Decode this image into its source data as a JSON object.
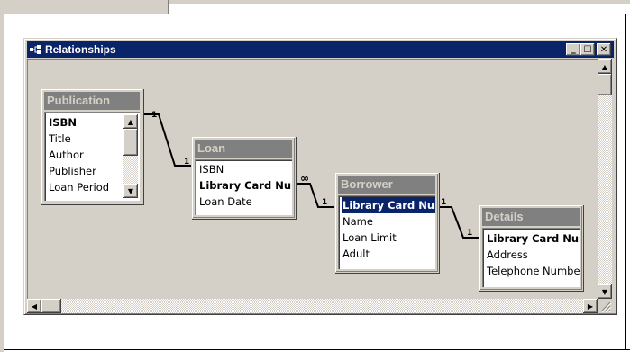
{
  "window": {
    "title": "Relationships",
    "buttons": {
      "minimize": "_",
      "maximize": "☐",
      "close": "✕"
    }
  },
  "tables": [
    {
      "name": "Publication",
      "fields": [
        {
          "label": "ISBN",
          "key": true
        },
        {
          "label": "Title",
          "key": false
        },
        {
          "label": "Author",
          "key": false
        },
        {
          "label": "Publisher",
          "key": false
        },
        {
          "label": "Loan Period",
          "key": false
        }
      ]
    },
    {
      "name": "Loan",
      "fields": [
        {
          "label": "ISBN",
          "key": false
        },
        {
          "label": "Library Card Num",
          "key": true
        },
        {
          "label": "Loan Date",
          "key": false
        }
      ]
    },
    {
      "name": "Borrower",
      "fields": [
        {
          "label": "Library Card Num",
          "key": true,
          "selected": true
        },
        {
          "label": "Name",
          "key": false
        },
        {
          "label": "Loan Limit",
          "key": false
        },
        {
          "label": "Adult",
          "key": false
        }
      ]
    },
    {
      "name": "Details",
      "fields": [
        {
          "label": "Library Card Num",
          "key": true
        },
        {
          "label": "Address",
          "key": false
        },
        {
          "label": "Telephone Number",
          "key": false
        }
      ]
    }
  ],
  "relationships": [
    {
      "from": "Publication.ISBN",
      "to": "Loan.ISBN",
      "from_label": "1",
      "to_label": "1"
    },
    {
      "from": "Loan.Library Card Num",
      "to": "Borrower.Library Card Num",
      "from_label": "∞",
      "to_label": "1"
    },
    {
      "from": "Borrower.Library Card Num",
      "to": "Details.Library Card Num",
      "from_label": "1",
      "to_label": "1"
    }
  ],
  "scroll": {
    "up": "▲",
    "down": "▼",
    "left": "◀",
    "right": "▶"
  },
  "colors": {
    "titlebar": "#0a246a",
    "table_header": "#808080",
    "face": "#d4d0c8"
  }
}
